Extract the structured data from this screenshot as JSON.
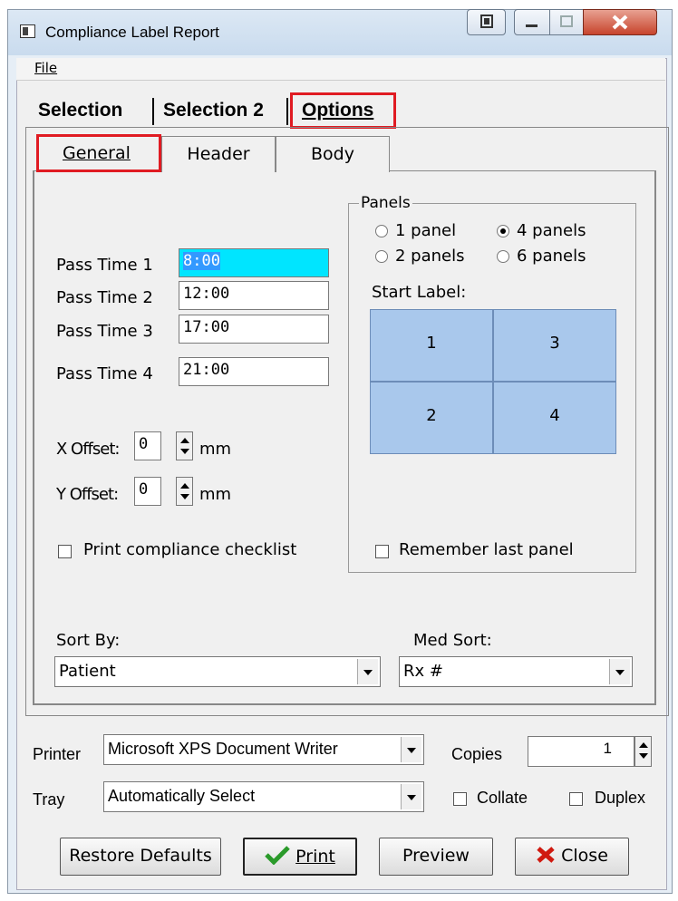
{
  "window": {
    "title": "Compliance Label Report"
  },
  "menu": {
    "file": "File"
  },
  "main_tabs": [
    "Selection",
    "Selection 2",
    "Options"
  ],
  "sub_tabs": [
    "General",
    "Header",
    "Body"
  ],
  "pass_times": [
    {
      "label": "Pass Time 1",
      "value": "8:00"
    },
    {
      "label": "Pass Time 2",
      "value": "12:00"
    },
    {
      "label": "Pass Time 3",
      "value": "17:00"
    },
    {
      "label": "Pass Time 4",
      "value": "21:00"
    }
  ],
  "offsets": {
    "x_label": "X Offset:",
    "x_value": "0",
    "y_label": "Y Offset:",
    "y_value": "0",
    "unit": "mm"
  },
  "print_checklist": {
    "label": "Print compliance checklist",
    "checked": false
  },
  "panels": {
    "title": "Panels",
    "options": [
      "1 panel",
      "4 panels",
      "2 panels",
      "6 panels"
    ],
    "selected": "4 panels",
    "start_label": "Start Label:",
    "grid": [
      "1",
      "3",
      "2",
      "4"
    ],
    "remember": {
      "label": "Remember last panel",
      "checked": false
    }
  },
  "sort": {
    "label": "Sort By:",
    "value": "Patient"
  },
  "med_sort": {
    "label": "Med Sort:",
    "value": "Rx #"
  },
  "printer": {
    "label": "Printer",
    "value": "Microsoft XPS Document Writer"
  },
  "copies": {
    "label": "Copies",
    "value": "1"
  },
  "tray": {
    "label": "Tray",
    "value": "Automatically Select"
  },
  "collate": {
    "label": "Collate",
    "checked": false
  },
  "duplex": {
    "label": "Duplex",
    "checked": false
  },
  "buttons": {
    "restore": "Restore Defaults",
    "print": "Print",
    "preview": "Preview",
    "close": "Close"
  },
  "colors": {
    "highlight_red": "#e01b22",
    "panel_blue": "#a9c8ec",
    "selected_field": "#00e5ff"
  }
}
